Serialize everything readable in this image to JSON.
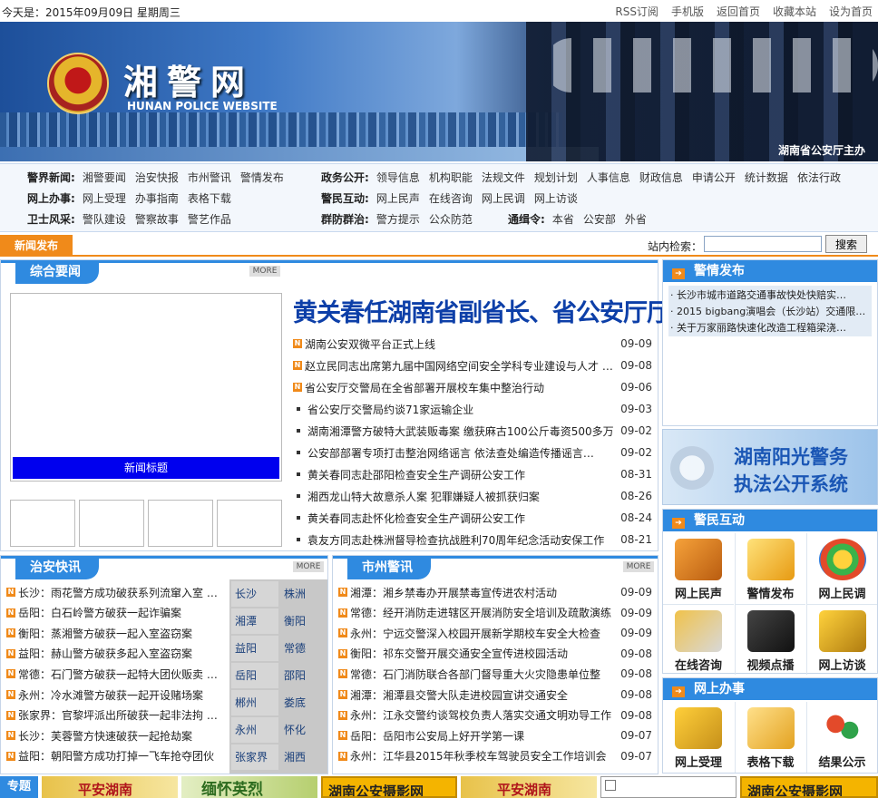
{
  "topbar": {
    "date": "今天是：2015年09月09日  星期周三",
    "links": [
      "RSS订阅",
      "手机版",
      "返回首页",
      "收藏本站",
      "设为首页"
    ]
  },
  "banner": {
    "title": "湘警网",
    "subtitle": "HUNAN POLICE WEBSITE",
    "sponsor": "湖南省公安厅主办"
  },
  "nav": {
    "rows": [
      [
        {
          "cat": "警界新闻:",
          "items": [
            "湘警要闻",
            "治安快报",
            "市州警讯",
            "警情发布"
          ]
        },
        {
          "cat": "政务公开:",
          "items": [
            "领导信息",
            "机构职能",
            "法规文件",
            "规划计划",
            "人事信息",
            "财政信息",
            "申请公开",
            "统计数据",
            "依法行政"
          ]
        }
      ],
      [
        {
          "cat": "网上办事:",
          "items": [
            "网上受理",
            "办事指南",
            "表格下载"
          ]
        },
        {
          "cat": "警民互动:",
          "items": [
            "网上民声",
            "在线咨询",
            "网上民调",
            "网上访谈"
          ]
        }
      ],
      [
        {
          "cat": "卫士风采:",
          "items": [
            "警队建设",
            "警察故事",
            "警艺作品"
          ]
        },
        {
          "cat": "群防群治:",
          "items": [
            "警方提示",
            "公众防范"
          ]
        },
        {
          "cat": "通缉令:",
          "items": [
            "本省",
            "公安部",
            "外省"
          ]
        }
      ]
    ]
  },
  "bar": {
    "tab": "新闻发布",
    "search_label": "站内检索：",
    "search_value": "",
    "search_button": "搜索"
  },
  "zonghe": {
    "title": "综合要闻",
    "more": "MORE",
    "headline": "黄关春任湖南省副省长、省公安厅厅长",
    "photo_caption": "新闻标题",
    "items": [
      {
        "icon": "n",
        "text": "湖南公安双微平台正式上线",
        "date": "09-09"
      },
      {
        "icon": "n",
        "text": "赵立民同志出席第九届中国网络空间安全学科专业建设与人才 …",
        "date": "09-08"
      },
      {
        "icon": "n",
        "text": "省公安厅交警局在全省部署开展校车集中整治行动",
        "date": "09-06"
      },
      {
        "icon": "dot",
        "text": "省公安厅交警局约谈71家运输企业",
        "date": "09-03"
      },
      {
        "icon": "dot",
        "text": "湖南湘潭警方破特大武装贩毒案 缴获麻古100公斤毒资500多万",
        "date": "09-02"
      },
      {
        "icon": "dot",
        "text": "公安部部署专项打击整治网络谣言 依法查处编造传播谣言…",
        "date": "09-02"
      },
      {
        "icon": "dot",
        "text": "黄关春同志赴邵阳检查安全生产调研公安工作",
        "date": "08-31"
      },
      {
        "icon": "dot",
        "text": "湘西龙山特大故意杀人案 犯罪嫌疑人被抓获归案",
        "date": "08-26"
      },
      {
        "icon": "dot",
        "text": "黄关春同志赴怀化检查安全生产调研公安工作",
        "date": "08-24"
      },
      {
        "icon": "dot",
        "text": "袁友方同志赴株洲督导检查抗战胜利70周年纪念活动安保工作",
        "date": "08-21"
      }
    ]
  },
  "jingqing": {
    "title": "警情发布",
    "items": [
      "长沙市城市道路交通事故快处快赔实…",
      "2015 bigbang演唱会（长沙站）交通限…",
      "关于万家丽路快速化改造工程箱梁浇…"
    ]
  },
  "yangguang": {
    "line1": "湖南阳光警务",
    "line2": "执法公开系统"
  },
  "jingmin": {
    "title": "警民互动",
    "items": [
      "网上民声",
      "警情发布",
      "网上民调",
      "在线咨询",
      "视频点播",
      "网上访谈"
    ]
  },
  "banshi": {
    "title": "网上办事",
    "items": [
      "网上受理",
      "表格下载",
      "结果公示"
    ]
  },
  "zhian": {
    "title": "治安快讯",
    "more": "MORE",
    "items": [
      {
        "text": "长沙：雨花警方成功破获系列流窜入室 …"
      },
      {
        "text": "岳阳：白石岭警方破获一起诈骗案"
      },
      {
        "text": "衡阳：蒸湘警方破获一起入室盗窃案"
      },
      {
        "text": "益阳：赫山警方破获多起入室盗窃案"
      },
      {
        "text": "常德：石门警方破获一起特大团伙贩卖 …"
      },
      {
        "text": "永州：冷水滩警方破获一起开设赌场案"
      },
      {
        "text": "张家界：官黎坪派出所破获一起非法拘 …"
      },
      {
        "text": "长沙：芙蓉警方快速破获一起抢劫案"
      },
      {
        "text": "益阳：朝阳警方成功打掉一飞车抢夺团伙"
      }
    ],
    "cities": [
      "长沙",
      "株洲",
      "湘潭",
      "衡阳",
      "益阳",
      "常德",
      "岳阳",
      "邵阳",
      "郴州",
      "娄底",
      "永州",
      "怀化",
      "张家界",
      "湘西"
    ]
  },
  "shizhou": {
    "title": "市州警讯",
    "more": "MORE",
    "items": [
      {
        "text": "湘潭：湘乡禁毒办开展禁毒宣传进农村活动",
        "date": "09-09"
      },
      {
        "text": "常德：经开消防走进辖区开展消防安全培训及疏散演练",
        "date": "09-09"
      },
      {
        "text": "永州：宁远交警深入校园开展新学期校车安全大检查",
        "date": "09-09"
      },
      {
        "text": "衡阳：祁东交警开展交通安全宣传进校园活动",
        "date": "09-08"
      },
      {
        "text": "常德：石门消防联合各部门督导重大火灾隐患单位整",
        "date": "09-08"
      },
      {
        "text": "湘潭：湘潭县交警大队走进校园宣讲交通安全",
        "date": "09-08"
      },
      {
        "text": "永州：江永交警约谈驾校负责人落实交通文明劝导工作",
        "date": "09-08"
      },
      {
        "text": "岳阳：岳阳市公安局上好开学第一课",
        "date": "09-07"
      },
      {
        "text": "永州：江华县2015年秋季校车驾驶员安全工作培训会",
        "date": "09-07"
      }
    ]
  },
  "zhuanti": {
    "label": "专题",
    "banners": [
      "平安湖南",
      "缅怀英烈",
      "湖南公安摄影网",
      "平安湖南",
      "",
      "湖南公安摄影网"
    ]
  },
  "colors": {
    "accent": "#2f8ae0",
    "orange": "#f08a1a",
    "headline": "#0d3fa8"
  }
}
